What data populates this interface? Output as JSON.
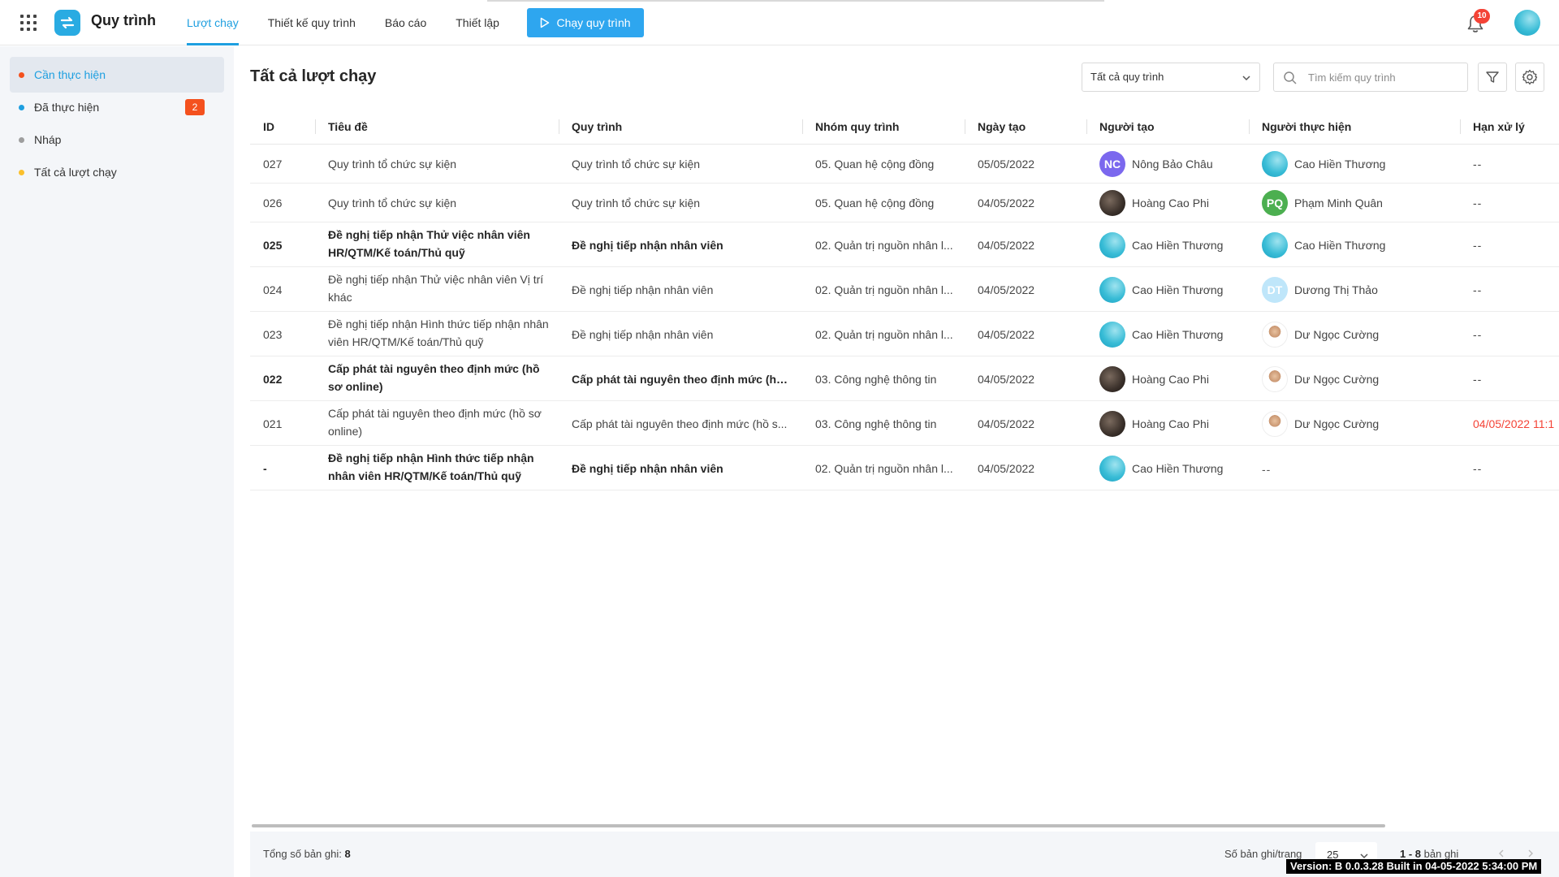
{
  "app": {
    "title": "Quy trình",
    "nav": [
      {
        "label": "Lượt chạy",
        "active": true
      },
      {
        "label": "Thiết kế quy trình",
        "active": false
      },
      {
        "label": "Báo cáo",
        "active": false
      },
      {
        "label": "Thiết lập",
        "active": false
      }
    ],
    "run_button": "Chạy quy trình",
    "notification_count": "10",
    "accent_color": "#1e9fe0"
  },
  "sidebar": {
    "items": [
      {
        "label": "Cần thực hiện",
        "dot_color": "#f4511e",
        "active": true,
        "badge": ""
      },
      {
        "label": "Đã thực hiện",
        "dot_color": "#1e9fe0",
        "active": false,
        "badge": "2"
      },
      {
        "label": "Nháp",
        "dot_color": "#9e9e9e",
        "active": false,
        "badge": ""
      },
      {
        "label": "Tất cả lượt chạy",
        "dot_color": "#fbc02d",
        "active": false,
        "badge": ""
      }
    ]
  },
  "main": {
    "title": "Tất cả lượt chạy",
    "process_select": "Tất cả quy trình",
    "search_placeholder": "Tìm kiếm quy trình"
  },
  "table": {
    "columns": [
      "ID",
      "Tiêu đề",
      "Quy trình",
      "Nhóm quy trình",
      "Ngày tạo",
      "Người tạo",
      "Người thực hiện",
      "Hạn xử lý"
    ],
    "rows": [
      {
        "id": "027",
        "title": "Quy trình tổ chức sự kiện",
        "process": "Quy trình tổ chức sự kiện",
        "group": "05. Quan hệ cộng đồng",
        "date": "05/05/2022",
        "creator": {
          "name": "Nông Bảo Châu",
          "initials": "NC",
          "avatar": "initials",
          "color": "#7b68ee"
        },
        "assignee": {
          "name": "Cao Hiền Thương",
          "initials": "",
          "avatar": "teal",
          "color": ""
        },
        "deadline": "--",
        "bold": false
      },
      {
        "id": "026",
        "title": "Quy trình tổ chức sự kiện",
        "process": "Quy trình tổ chức sự kiện",
        "group": "05. Quan hệ cộng đồng",
        "date": "04/05/2022",
        "creator": {
          "name": "Hoàng Cao Phi",
          "initials": "",
          "avatar": "dark",
          "color": ""
        },
        "assignee": {
          "name": "Phạm Minh Quân",
          "initials": "PQ",
          "avatar": "initials",
          "color": "#4caf50"
        },
        "deadline": "--",
        "bold": false
      },
      {
        "id": "025",
        "title": "Đề nghị tiếp nhận Thử việc nhân viên HR/QTM/Kế toán/Thủ quỹ",
        "process": "Đề nghị tiếp nhận nhân viên",
        "group": "02. Quản trị nguồn nhân l...",
        "date": "04/05/2022",
        "creator": {
          "name": "Cao Hiền Thương",
          "initials": "",
          "avatar": "teal",
          "color": ""
        },
        "assignee": {
          "name": "Cao Hiền Thương",
          "initials": "",
          "avatar": "teal",
          "color": ""
        },
        "deadline": "--",
        "bold": true
      },
      {
        "id": "024",
        "title": "Đề nghị tiếp nhận Thử việc nhân viên Vị trí khác",
        "process": "Đề nghị tiếp nhận nhân viên",
        "group": "02. Quản trị nguồn nhân l...",
        "date": "04/05/2022",
        "creator": {
          "name": "Cao Hiền Thương",
          "initials": "",
          "avatar": "teal",
          "color": ""
        },
        "assignee": {
          "name": "Dương Thị Thảo",
          "initials": "DT",
          "avatar": "initials",
          "color": "#bfe6fa"
        },
        "deadline": "--",
        "bold": false
      },
      {
        "id": "023",
        "title": "Đề nghị tiếp nhận Hình thức tiếp nhận nhân viên HR/QTM/Kế toán/Thủ quỹ",
        "process": "Đề nghị tiếp nhận nhân viên",
        "group": "02. Quản trị nguồn nhân l...",
        "date": "04/05/2022",
        "creator": {
          "name": "Cao Hiền Thương",
          "initials": "",
          "avatar": "teal",
          "color": ""
        },
        "assignee": {
          "name": "Dư Ngọc Cường",
          "initials": "",
          "avatar": "man",
          "color": ""
        },
        "deadline": "--",
        "bold": false
      },
      {
        "id": "022",
        "title": "Cấp phát tài nguyên theo định mức (hồ sơ online)",
        "process": "Cấp phát tài nguyên theo định mức (hồ s...",
        "group": "03. Công nghệ thông tin",
        "date": "04/05/2022",
        "creator": {
          "name": "Hoàng Cao Phi",
          "initials": "",
          "avatar": "dark",
          "color": ""
        },
        "assignee": {
          "name": "Dư Ngọc Cường",
          "initials": "",
          "avatar": "man",
          "color": ""
        },
        "deadline": "--",
        "bold": true
      },
      {
        "id": "021",
        "title": "Cấp phát tài nguyên theo định mức (hồ sơ online)",
        "process": "Cấp phát tài nguyên theo định mức (hồ s...",
        "group": "03. Công nghệ thông tin",
        "date": "04/05/2022",
        "creator": {
          "name": "Hoàng Cao Phi",
          "initials": "",
          "avatar": "dark",
          "color": ""
        },
        "assignee": {
          "name": "Dư Ngọc Cường",
          "initials": "",
          "avatar": "man",
          "color": ""
        },
        "deadline": "04/05/2022 11:1",
        "deadline_color": "#f44336",
        "bold": false
      },
      {
        "id": "-",
        "title": "Đề nghị tiếp nhận Hình thức tiếp nhận nhân viên HR/QTM/Kế toán/Thủ quỹ",
        "process": "Đề nghị tiếp nhận nhân viên",
        "group": "02. Quản trị nguồn nhân l...",
        "date": "04/05/2022",
        "creator": {
          "name": "Cao Hiền Thương",
          "initials": "",
          "avatar": "teal",
          "color": ""
        },
        "assignee": {
          "name": "--",
          "initials": "",
          "avatar": "none",
          "color": ""
        },
        "deadline": "--",
        "bold": true
      }
    ]
  },
  "footer": {
    "total_label": "Tổng số bản ghi:",
    "total_value": "8",
    "per_page_label": "Số bản ghi/trang",
    "per_page_value": "25",
    "range_value": "1 - 8",
    "range_suffix": "bản ghi"
  },
  "version_text": "Version: B 0.0.3.28 Built in 04-05-2022 5:34:00 PM"
}
